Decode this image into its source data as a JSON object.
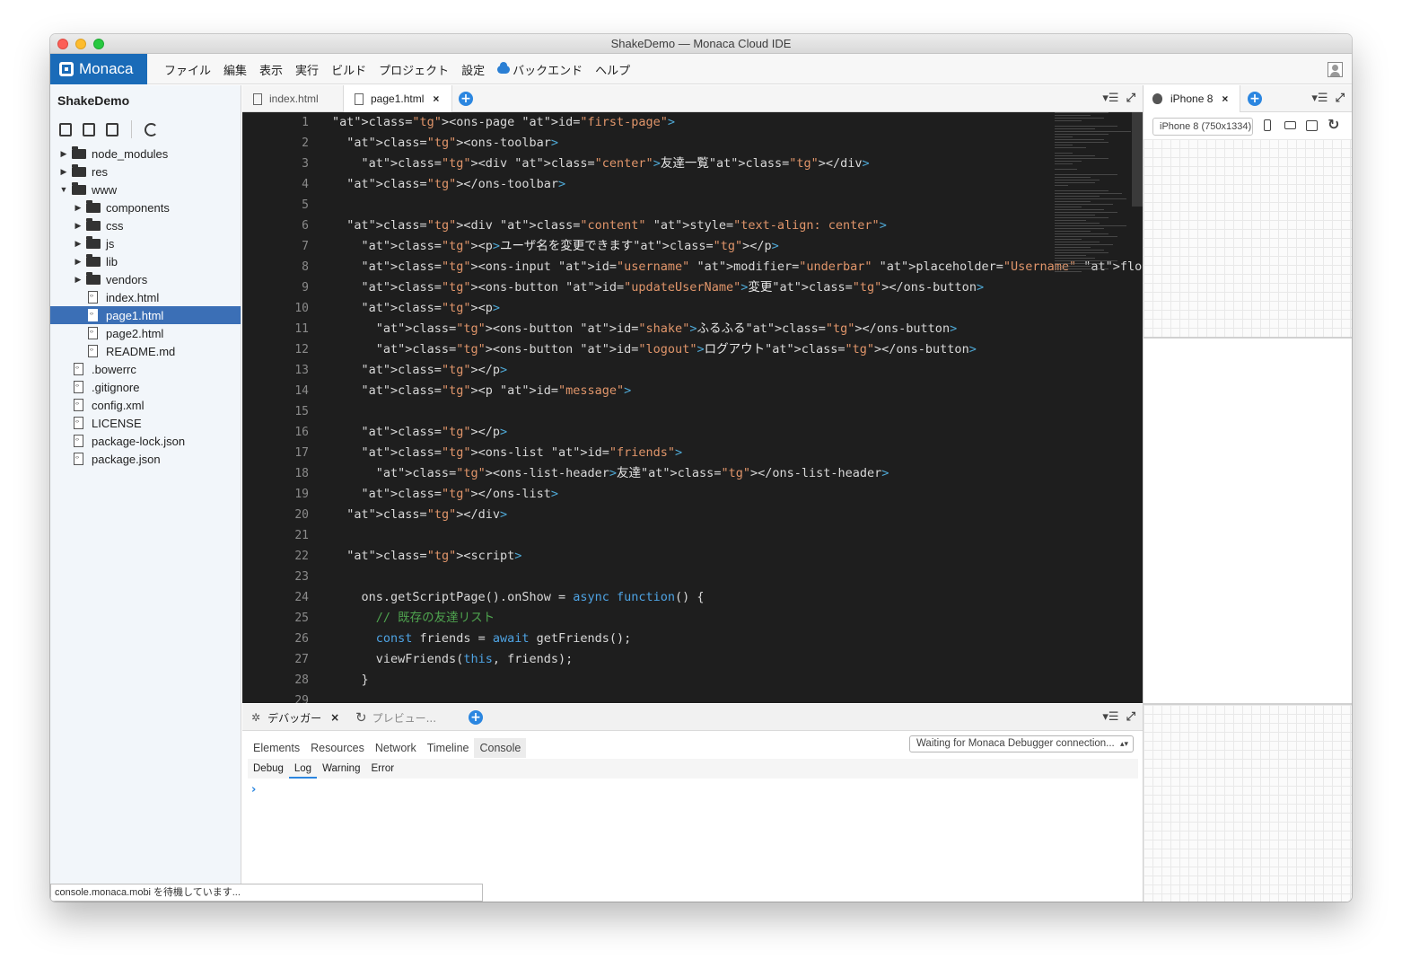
{
  "window": {
    "title": "ShakeDemo — Monaca Cloud IDE"
  },
  "app": {
    "logo": "Monaca"
  },
  "menu": [
    "ファイル",
    "編集",
    "表示",
    "実行",
    "ビルド",
    "プロジェクト",
    "設定",
    "バックエンド",
    "ヘルプ"
  ],
  "sidebar": {
    "project": "ShakeDemo",
    "tree": [
      {
        "label": "node_modules",
        "type": "folder",
        "depth": 0,
        "expanded": false
      },
      {
        "label": "res",
        "type": "folder",
        "depth": 0,
        "expanded": false
      },
      {
        "label": "www",
        "type": "folder",
        "depth": 0,
        "expanded": true
      },
      {
        "label": "components",
        "type": "folder",
        "depth": 1,
        "expanded": false
      },
      {
        "label": "css",
        "type": "folder",
        "depth": 1,
        "expanded": false
      },
      {
        "label": "js",
        "type": "folder",
        "depth": 1,
        "expanded": false
      },
      {
        "label": "lib",
        "type": "folder",
        "depth": 1,
        "expanded": false
      },
      {
        "label": "vendors",
        "type": "folder",
        "depth": 1,
        "expanded": false
      },
      {
        "label": "index.html",
        "type": "file",
        "depth": 1
      },
      {
        "label": "page1.html",
        "type": "file",
        "depth": 1,
        "selected": true
      },
      {
        "label": "page2.html",
        "type": "file",
        "depth": 1
      },
      {
        "label": "README.md",
        "type": "file",
        "depth": 1
      },
      {
        "label": ".bowerrc",
        "type": "file",
        "depth": 0
      },
      {
        "label": ".gitignore",
        "type": "file",
        "depth": 0
      },
      {
        "label": "config.xml",
        "type": "file",
        "depth": 0
      },
      {
        "label": "LICENSE",
        "type": "file",
        "depth": 0
      },
      {
        "label": "package-lock.json",
        "type": "file",
        "depth": 0
      },
      {
        "label": "package.json",
        "type": "file",
        "depth": 0
      }
    ]
  },
  "editor": {
    "tabs": [
      {
        "label": "index.html",
        "active": false
      },
      {
        "label": "page1.html",
        "active": true
      }
    ],
    "line_numbers": [
      "1",
      "2",
      "3",
      "4",
      "5",
      "6",
      "7",
      "8",
      "9",
      "10",
      "11",
      "12",
      "13",
      "14",
      "15",
      "16",
      "17",
      "18",
      "19",
      "20",
      "21",
      "22",
      "23",
      "24",
      "25",
      "26",
      "27",
      "28",
      "29"
    ],
    "code": [
      "<ons-page id=\"first-page\">",
      "  <ons-toolbar>",
      "    <div class=\"center\">友達一覧</div>",
      "  </ons-toolbar>",
      "",
      "  <div class=\"content\" style=\"text-align: center\">",
      "    <p>ユーザ名を変更できます</p>",
      "    <ons-input id=\"username\" modifier=\"underbar\" placeholder=\"Username\" float></ons-input>",
      "    <ons-button id=\"updateUserName\">変更</ons-button>",
      "    <p>",
      "      <ons-button id=\"shake\">ふるふる</ons-button>",
      "      <ons-button id=\"logout\">ログアウト</ons-button>",
      "    </p>",
      "    <p id=\"message\">",
      "",
      "    </p>",
      "    <ons-list id=\"friends\">",
      "      <ons-list-header>友達</ons-list-header>",
      "    </ons-list>",
      "  </div>",
      "",
      "  <script>",
      "",
      "    ons.getScriptPage().onShow = async function() {",
      "      // 既存の友達リスト",
      "      const friends = await getFriends();",
      "      viewFriends(this, friends);",
      "    }",
      ""
    ]
  },
  "debugger": {
    "tabs": [
      {
        "label": "デバッガー",
        "active": true
      },
      {
        "label": "プレビュー...",
        "active": false
      }
    ],
    "devtools_tabs": [
      "Elements",
      "Resources",
      "Network",
      "Timeline",
      "Console"
    ],
    "active_devtools_tab": "Console",
    "connection": "Waiting for Monaca Debugger connection...",
    "levels": [
      "Debug",
      "Log",
      "Warning",
      "Error"
    ],
    "active_level": "Log",
    "prompt": "›"
  },
  "preview": {
    "tab": "iPhone 8",
    "device": "iPhone 8 (750x1334)"
  },
  "status": "console.monaca.mobi を待機しています..."
}
